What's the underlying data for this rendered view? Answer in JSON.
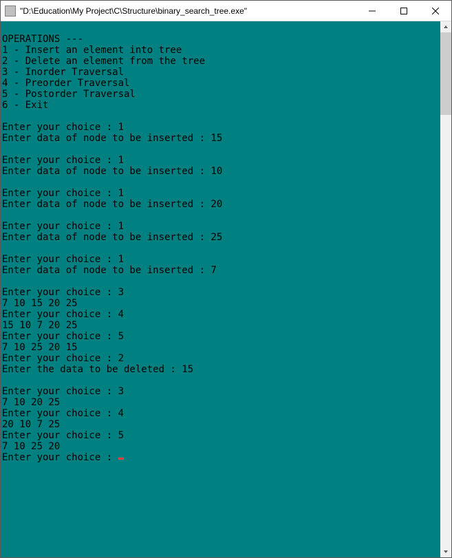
{
  "titlebar": {
    "title": "\"D:\\Education\\My Project\\C\\Structure\\binary_search_tree.exe\""
  },
  "console": {
    "lines": [
      "",
      "OPERATIONS ---",
      "1 - Insert an element into tree",
      "2 - Delete an element from the tree",
      "3 - Inorder Traversal",
      "4 - Preorder Traversal",
      "5 - Postorder Traversal",
      "6 - Exit",
      "",
      "Enter your choice : 1",
      "Enter data of node to be inserted : 15",
      "",
      "Enter your choice : 1",
      "Enter data of node to be inserted : 10",
      "",
      "Enter your choice : 1",
      "Enter data of node to be inserted : 20",
      "",
      "Enter your choice : 1",
      "Enter data of node to be inserted : 25",
      "",
      "Enter your choice : 1",
      "Enter data of node to be inserted : 7",
      "",
      "Enter your choice : 3",
      "7 10 15 20 25",
      "Enter your choice : 4",
      "15 10 7 20 25",
      "Enter your choice : 5",
      "7 10 25 20 15",
      "Enter your choice : 2",
      "Enter the data to be deleted : 15",
      "",
      "Enter your choice : 3",
      "7 10 20 25",
      "Enter your choice : 4",
      "20 10 7 25",
      "Enter your choice : 5",
      "7 10 25 20"
    ],
    "prompt_inline": "Enter your choice : "
  }
}
